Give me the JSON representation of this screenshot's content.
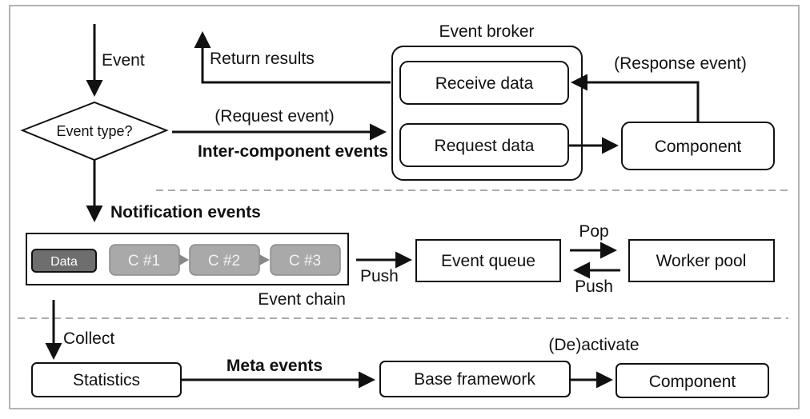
{
  "colors": {
    "data_block": "#6e6e6e",
    "component_block": "#a9a9a9",
    "divider": "#aaaaaa",
    "line": "#111111"
  },
  "top": {
    "event_label": "Event",
    "decision": "Event type?",
    "return_results": "Return results",
    "request_event": "(Request event)",
    "inter_component": "Inter-component events",
    "broker_title": "Event broker",
    "receive_data": "Receive data",
    "request_data": "Request data",
    "response_event": "(Response event)",
    "component": "Component"
  },
  "middle": {
    "notification": "Notification events",
    "chain_items": [
      "Data",
      "C #1",
      "C #2",
      "C #3"
    ],
    "event_chain": "Event chain",
    "push_in": "Push",
    "event_queue": "Event queue",
    "pop": "Pop",
    "push_back": "Push",
    "worker_pool": "Worker pool"
  },
  "bottom": {
    "collect": "Collect",
    "statistics": "Statistics",
    "meta_events": "Meta events",
    "deactivate": "(De)activate",
    "base_framework": "Base framework",
    "component": "Component"
  }
}
